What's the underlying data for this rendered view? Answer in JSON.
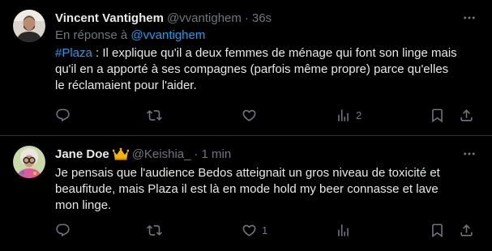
{
  "colors": {
    "background": "#000000",
    "text": "#e7e9ea",
    "muted": "#71767b",
    "accent": "#1d9bf0",
    "divider": "#2f3336",
    "crown": "#f4b400"
  },
  "tweets": [
    {
      "author_name": "Vincent Vantighem",
      "handle": "@vvantighem",
      "dot": "·",
      "time": "36s",
      "reply_prefix": "En réponse à",
      "reply_mention": "@vvantighem",
      "hashtag": "#Plaza",
      "text": " : Il explique qu'il a deux femmes de ménage qui font son linge mais qu'il en a apporté à ses compagnes (parfois même propre) parce qu'elles le réclamaient pour l'aider.",
      "avatar_icon": "avatar-photo",
      "actions": {
        "reply_count": "",
        "retweet_count": "",
        "like_count": "",
        "views_count": "2"
      }
    },
    {
      "author_name": "Jane Doe",
      "badge_icon": "crown-icon",
      "handle": "@Keishia_",
      "dot": "·",
      "time": "1 min",
      "text": "Je pensais que l'audience Bedos atteignait un gros niveau de toxicité et beaufitude, mais Plaza il est là en mode hold my beer connasse et lave mon linge.",
      "avatar_icon": "avatar-photo",
      "actions": {
        "reply_count": "",
        "retweet_count": "",
        "like_count": "1",
        "views_count": ""
      }
    }
  ]
}
